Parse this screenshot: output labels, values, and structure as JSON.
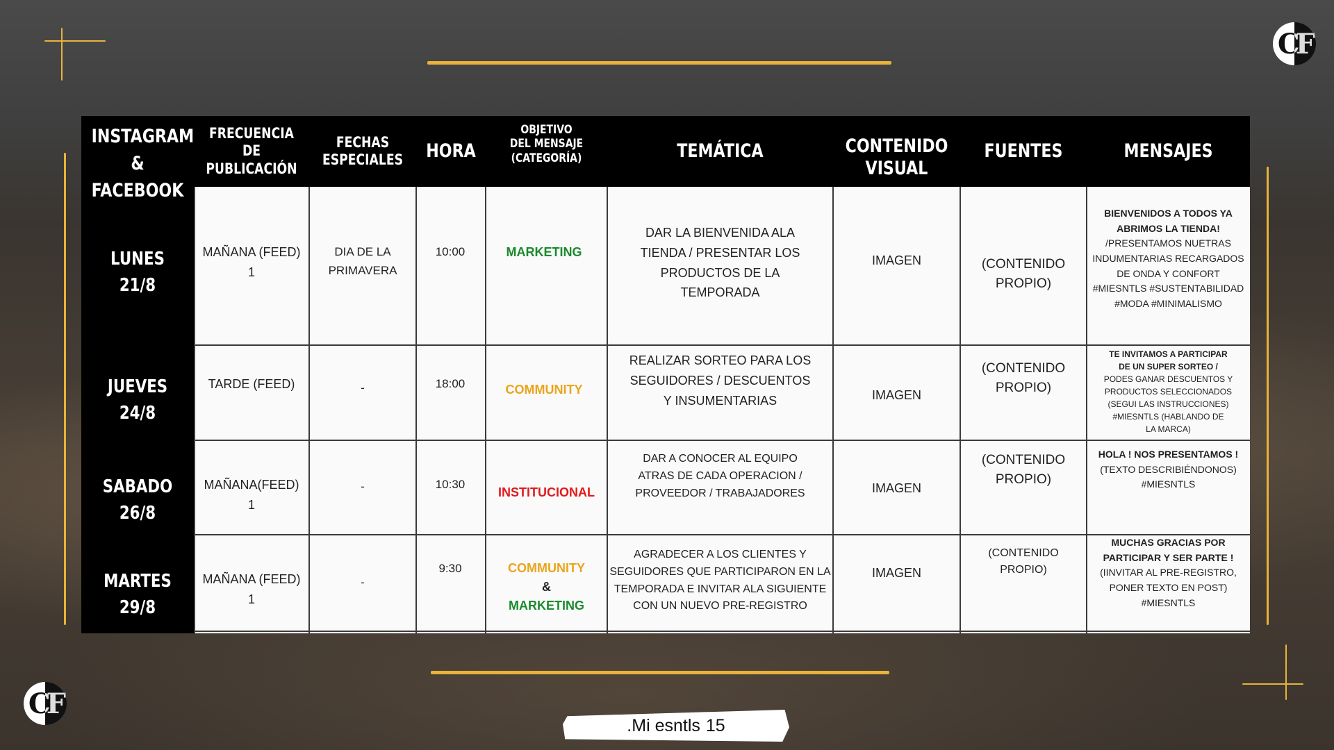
{
  "logo_text": "CF",
  "header": {
    "channel_line1": "INSTAGRAM",
    "channel_line2": "&",
    "channel_line3": "FACEBOOK",
    "col_frecuencia_1": "FRECUENCIA",
    "col_frecuencia_2": "DE PUBLICACIÓN",
    "col_fechas_1": "FECHAS",
    "col_fechas_2": "ESPECIALES",
    "col_hora": "HORA",
    "col_objetivo_1": "OBJETIVO",
    "col_objetivo_2": "DEL MENSAJE",
    "col_objetivo_3": "(CATEGORÍA)",
    "col_tematica": "TEMÁTICA",
    "col_contenido_1": "CONTENIDO",
    "col_contenido_2": "VISUAL",
    "col_fuentes": "FUENTES",
    "col_mensajes": "MENSAJES"
  },
  "colors": {
    "marketing": "#1b8a2e",
    "community": "#eaa51c",
    "institucional": "#e2191b",
    "accent": "#e9b23a"
  },
  "rows": [
    {
      "day": "LUNES",
      "date": "21/8",
      "frecuencia_1": "MAÑANA (FEED)",
      "frecuencia_2": "1",
      "fechas_1": "DIA DE LA",
      "fechas_2": "PRIMAVERA",
      "hora": "10:00",
      "categoria": "MARKETING",
      "tematica_1": "DAR LA BIENVENIDA ALA",
      "tematica_2": "TIENDA / PRESENTAR LOS",
      "tematica_3": "PRODUCTOS  DE LA",
      "tematica_4": "TEMPORADA",
      "contenido": "IMAGEN",
      "fuentes_1": "(CONTENIDO",
      "fuentes_2": "PROPIO)",
      "mensaje_bold_1": "BIENVENIDOS A TODOS YA",
      "mensaje_bold_2": "ABRIMOS LA TIENDA!",
      "mensaje_1": "/PRESENTAMOS NUETRAS",
      "mensaje_2": "INDUMENTARIAS RECARGADOS",
      "mensaje_3": "DE ONDA Y CONFORT",
      "mensaje_4": "#MIESNTLS #SUSTENTABILIDAD",
      "mensaje_5": "#MODA #MINIMALISMO"
    },
    {
      "day": "JUEVES",
      "date": "24/8",
      "frecuencia_1": "TARDE (FEED)",
      "fechas_1": "-",
      "hora": "18:00",
      "categoria": "COMMUNITY",
      "tematica_1": "REALIZAR SORTEO PARA LOS",
      "tematica_2": "SEGUIDORES / DESCUENTOS",
      "tematica_3": "Y INSUMENTARIAS",
      "contenido": "IMAGEN",
      "fuentes_1": "(CONTENIDO",
      "fuentes_2": "PROPIO)",
      "mensaje_bold_1": "TE INVITAMOS A PARTICIPAR",
      "mensaje_bold_2": "DE UN SUPER SORTEO /",
      "mensaje_1": "PODES GANAR DESCUENTOS Y",
      "mensaje_2": "PRODUCTOS SELECCIONADOS",
      "mensaje_3": "(SEGUI LAS INSTRUCCIONES)",
      "mensaje_4": "#MIESNTLS (HABLANDO DE",
      "mensaje_5": "LA MARCA)"
    },
    {
      "day": "SABADO",
      "date": "26/8",
      "frecuencia_1": "MAÑANA(FEED)",
      "frecuencia_2": "1",
      "fechas_1": "-",
      "hora": "10:30",
      "categoria": "INSTITUCIONAL",
      "tematica_1": "DAR A CONOCER AL EQUIPO",
      "tematica_2": "ATRAS DE CADA OPERACION /",
      "tematica_3": "PROVEEDOR / TRABAJADORES",
      "contenido": "IMAGEN",
      "fuentes_1": "(CONTENIDO",
      "fuentes_2": "PROPIO)",
      "mensaje_bold_1": "HOLA ! NOS PRESENTAMOS !",
      "mensaje_1": "(TEXTO DESCRIBIÉNDONOS)",
      "mensaje_2": "#MIESNTLS"
    },
    {
      "day": "MARTES",
      "date": "29/8",
      "frecuencia_1": "MAÑANA (FEED)",
      "frecuencia_2": "1",
      "fechas_1": "-",
      "hora": "9:30",
      "categoria_1": "COMMUNITY",
      "categoria_amp": "&",
      "categoria_2": "MARKETING",
      "tematica_1": "AGRADECER A LOS CLIENTES Y",
      "tematica_2": "SEGUIDORES QUE PARTICIPARON EN LA",
      "tematica_3": "TEMPORADA E INVITAR ALA SIGUIENTE",
      "tematica_4": "CON UN NUEVO PRE-REGISTRO",
      "contenido": "IMAGEN",
      "fuentes_1": "(CONTENIDO",
      "fuentes_2": "PROPIO)",
      "mensaje_bold_1": "MUCHAS GRACIAS  POR",
      "mensaje_bold_2": "PARTICIPAR Y SER PARTE !",
      "mensaje_1": "(IINVITAR AL PRE-REGISTRO,",
      "mensaje_2": "PONER TEXTO EN POST)",
      "mensaje_3": "#MIESNTLS"
    }
  ],
  "footer": {
    "brand": ".Mi esntls",
    "page": "15"
  }
}
